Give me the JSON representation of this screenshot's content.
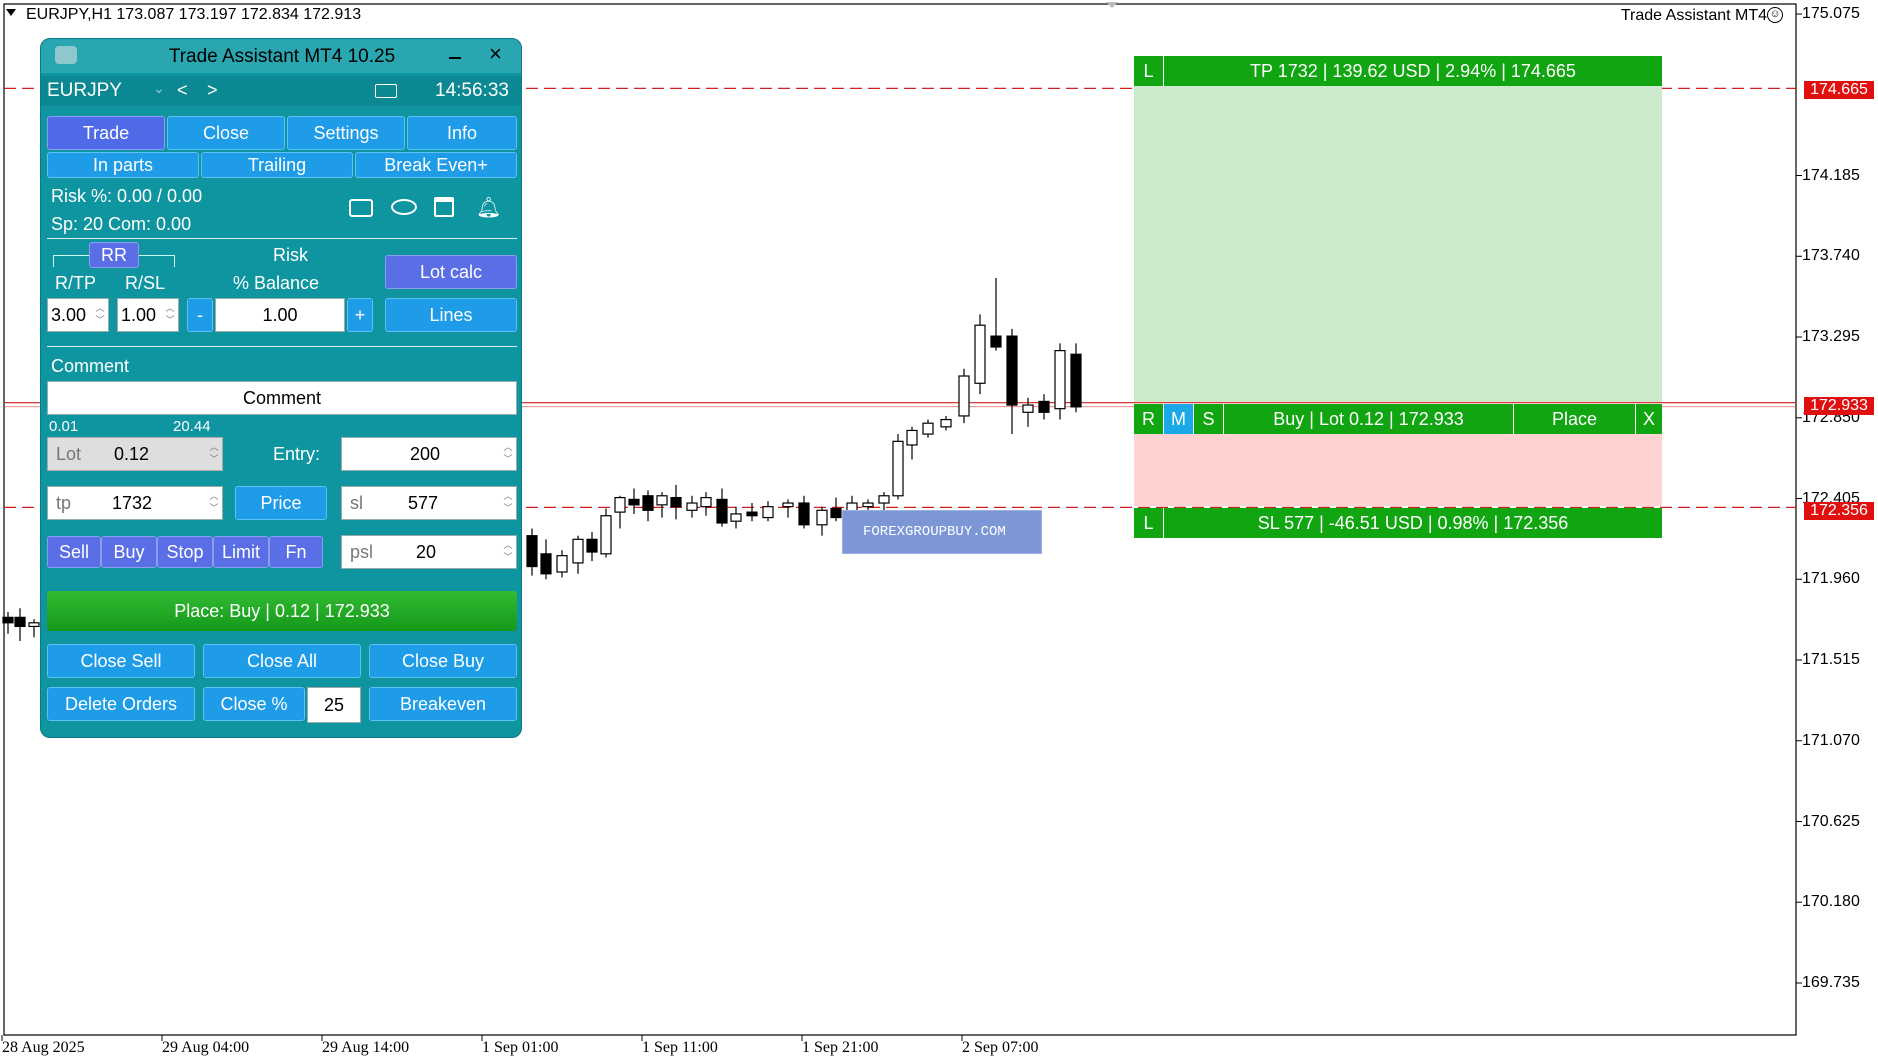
{
  "chart": {
    "title": "EURJPY,H1  173.087 173.197 172.834 172.913",
    "ea_name": "Trade Assistant MT4",
    "price_ticks": [
      "175.075",
      "174.185",
      "173.740",
      "173.295",
      "172.850",
      "172.405",
      "171.960",
      "171.515",
      "171.070",
      "170.625",
      "170.180",
      "169.735"
    ],
    "time_ticks": [
      "28 Aug 2025",
      "29 Aug 04:00",
      "29 Aug 14:00",
      "1 Sep 01:00",
      "1 Sep 11:00",
      "1 Sep 21:00",
      "2 Sep 07:00"
    ],
    "tp_price": "174.665",
    "entry_price": "172.933",
    "sl_price": "172.356",
    "tp_color": "#e01010",
    "bull_color": "#ffffff",
    "bear_color": "#000000"
  },
  "position_tool": {
    "tp_label_left": "L",
    "tp_text": "TP 1732 | 139.62 USD | 2.94% | 174.665",
    "entry_r": "R",
    "entry_m": "M",
    "entry_s": "S",
    "entry_text": "Buy | Lot 0.12 | 172.933",
    "place": "Place",
    "close": "X",
    "sl_label_left": "L",
    "sl_text": "SL 577 | -46.51 USD | 0.98% | 172.356",
    "profit_color": "#cdeacd",
    "loss_color": "#ffd1d1"
  },
  "watermark": "FOREXGROUPBUY.COM",
  "panel": {
    "title": "Trade Assistant MT4 10.25",
    "symbol": "EURJPY",
    "prev": "<",
    "next": ">",
    "time": "14:56:33",
    "tabs": [
      "Trade",
      "Close",
      "Settings",
      "Info"
    ],
    "subtabs": [
      "In parts",
      "Trailing",
      "Break Even+"
    ],
    "risk_line": "Risk %: 0.00 /  0.00",
    "sp_line": "Sp: 20  Com: 0.00",
    "rr": "RR",
    "rtp_label": "R/TP",
    "rsl_label": "R/SL",
    "risk_label": "Risk",
    "balance_label": "% Balance",
    "lot_calc": "Lot calc",
    "rtp_value": "3.00",
    "rsl_value": "1.00",
    "minus": "-",
    "risk_value": "1.00",
    "plus": "+",
    "lines": "Lines",
    "comment_label": "Comment",
    "comment_value": "Comment",
    "lot_min": "0.01",
    "lot_max": "20.44",
    "lot_hint": "Lot",
    "lot_value": "0.12",
    "entry_label": "Entry:",
    "entry_value": "200",
    "tp_hint": "tp",
    "tp_value": "1732",
    "price_btn": "Price",
    "sl_hint": "sl",
    "sl_value": "577",
    "order_types": [
      "Sell",
      "Buy",
      "Stop",
      "Limit",
      "Fn"
    ],
    "psl_hint": "psl",
    "psl_value": "20",
    "place_btn": "Place: Buy | 0.12 | 172.933",
    "close_sell": "Close Sell",
    "close_all": "Close All",
    "close_buy": "Close Buy",
    "delete_orders": "Delete Orders",
    "close_pct": "Close %",
    "close_pct_value": "25",
    "breakeven": "Breakeven"
  }
}
